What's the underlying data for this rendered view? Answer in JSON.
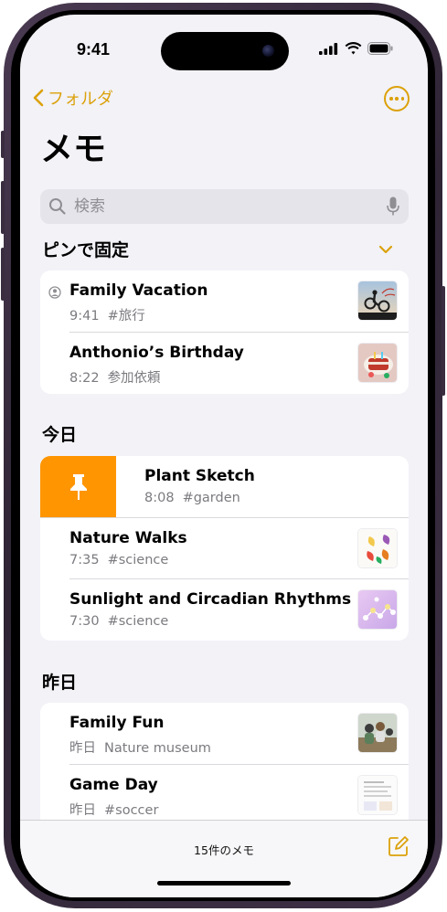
{
  "status_bar": {
    "time": "9:41"
  },
  "nav": {
    "back_label": "フォルダ"
  },
  "page_title": "メモ",
  "search": {
    "placeholder": "検索"
  },
  "sections": {
    "pinned": {
      "title": "ピンで固定",
      "items": [
        {
          "title": "Family Vacation",
          "time": "9:41",
          "detail": "#旅行",
          "shared": true
        },
        {
          "title": "Anthonio’s Birthday",
          "time": "8:22",
          "detail": "参加依頼"
        }
      ]
    },
    "today": {
      "title": "今日",
      "items": [
        {
          "title": "Plant Sketch",
          "time": "8:08",
          "detail": "#garden",
          "swiped": true
        },
        {
          "title": "Nature Walks",
          "time": "7:35",
          "detail": "#science"
        },
        {
          "title": "Sunlight and Circadian Rhythms",
          "time": "7:30",
          "detail": "#science"
        }
      ]
    },
    "yesterday": {
      "title": "昨日",
      "items": [
        {
          "title": "Family Fun",
          "time": "昨日",
          "detail": "Nature museum"
        },
        {
          "title": "Game Day",
          "time": "昨日",
          "detail": "#soccer"
        }
      ]
    }
  },
  "toolbar": {
    "note_count": "15件のメモ"
  },
  "colors": {
    "accent": "#dca10a",
    "pin_action": "#ff9500",
    "background": "#f2f2f7"
  },
  "icons": {
    "back": "chevron-left-icon",
    "more": "ellipsis-circle-icon",
    "search": "magnifier-icon",
    "mic": "microphone-icon",
    "collapse": "chevron-down-icon",
    "shared": "person-circle-icon",
    "pin": "pin-icon",
    "compose": "compose-icon"
  }
}
